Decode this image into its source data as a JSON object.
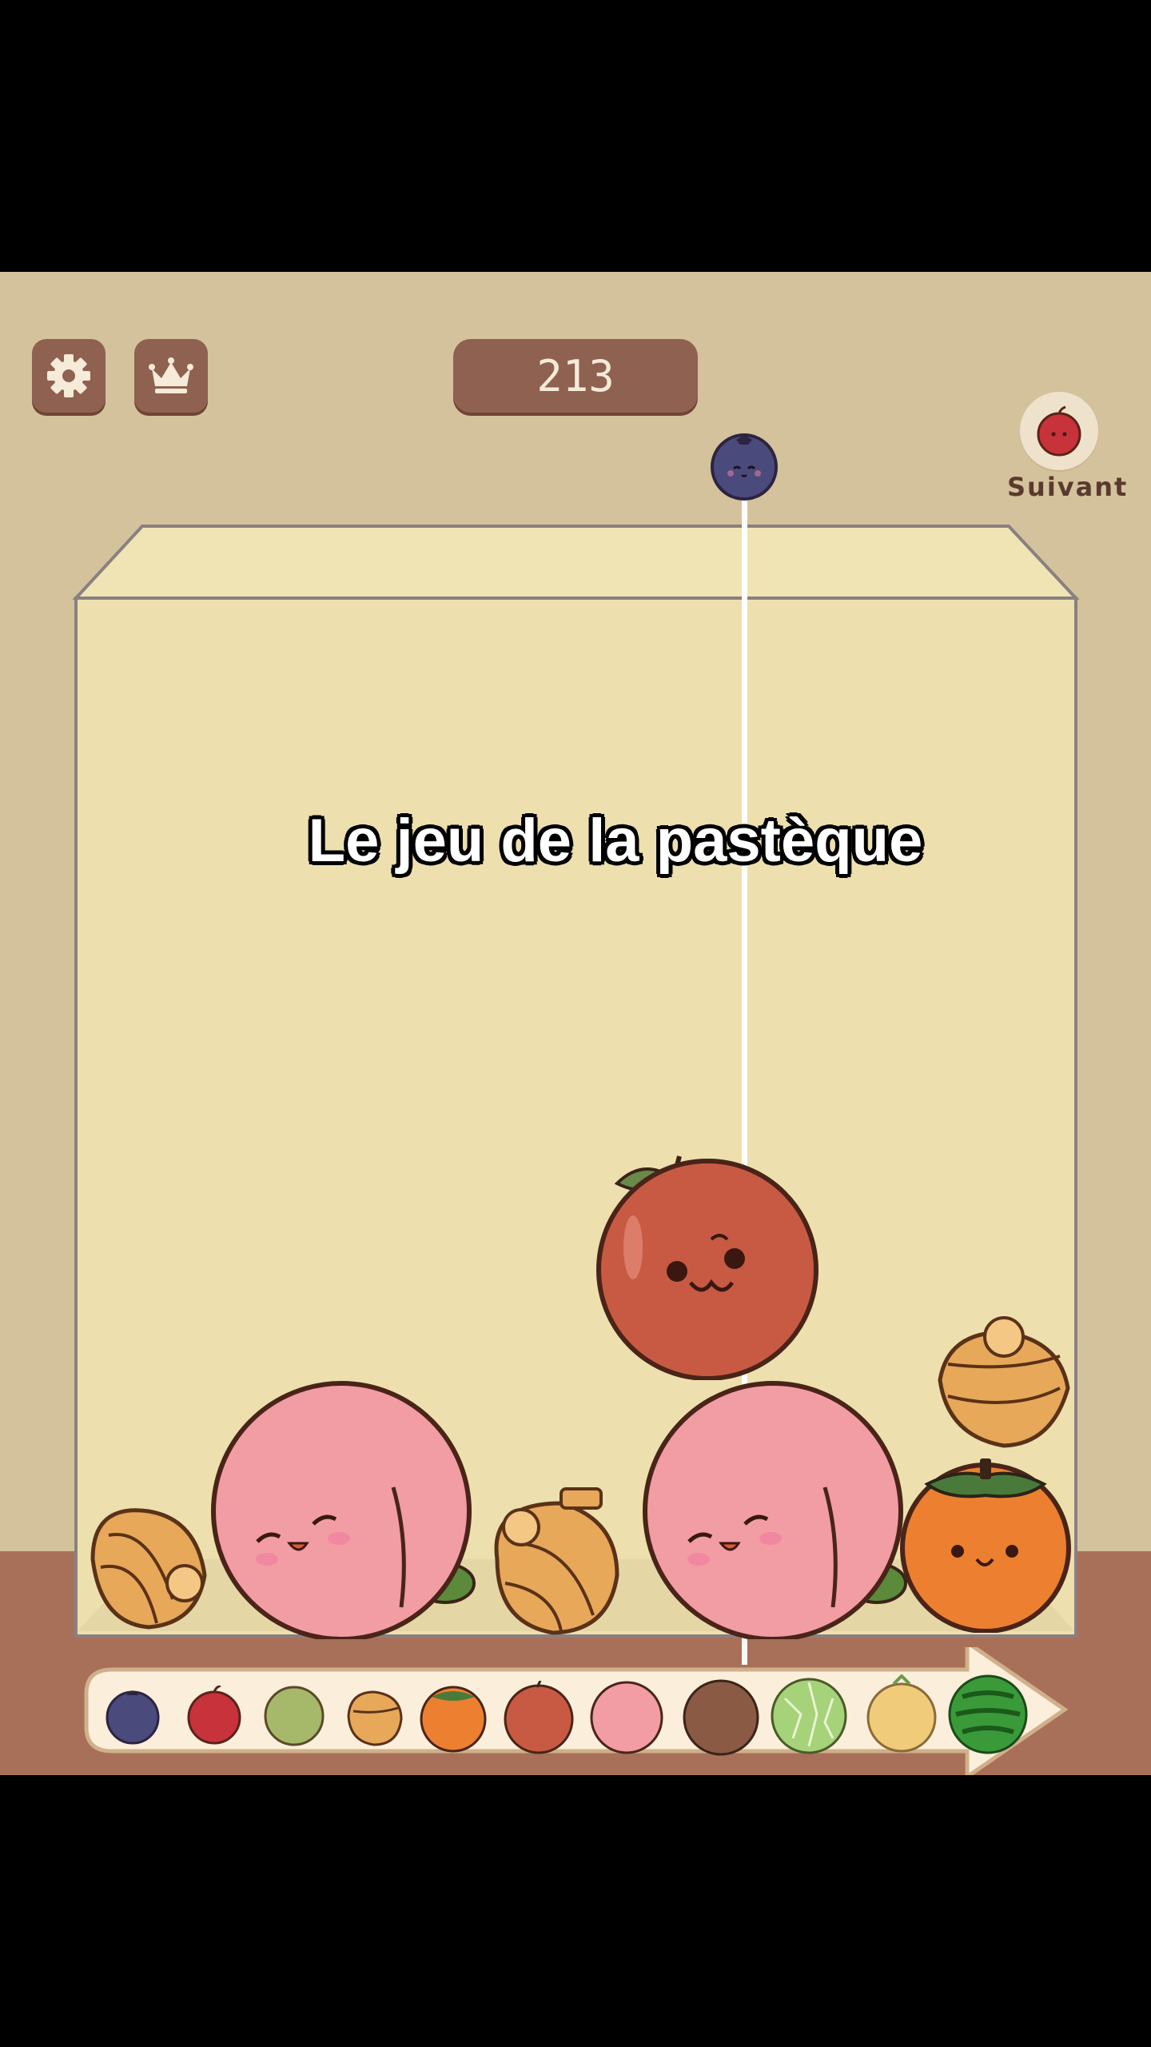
{
  "title": "Le jeu de la pastèque",
  "score": "213",
  "next": {
    "label": "Suivant",
    "fruit": "cherry"
  },
  "buttons": {
    "settings_icon": "gear-icon",
    "leaderboard_icon": "crown-icon"
  },
  "current_fruit": "blueberry",
  "container_fruits": [
    "banana",
    "peach",
    "banana",
    "apple",
    "peach",
    "banana",
    "persimmon"
  ],
  "evolution": [
    "blueberry",
    "cherry",
    "lime",
    "banana",
    "persimmon",
    "apple",
    "peach",
    "coconut",
    "melon",
    "pineapple",
    "watermelon"
  ],
  "colors": {
    "background": "#d4c29c",
    "container": "#ede0ae",
    "button": "#8f6150",
    "floor": "#a87058"
  }
}
